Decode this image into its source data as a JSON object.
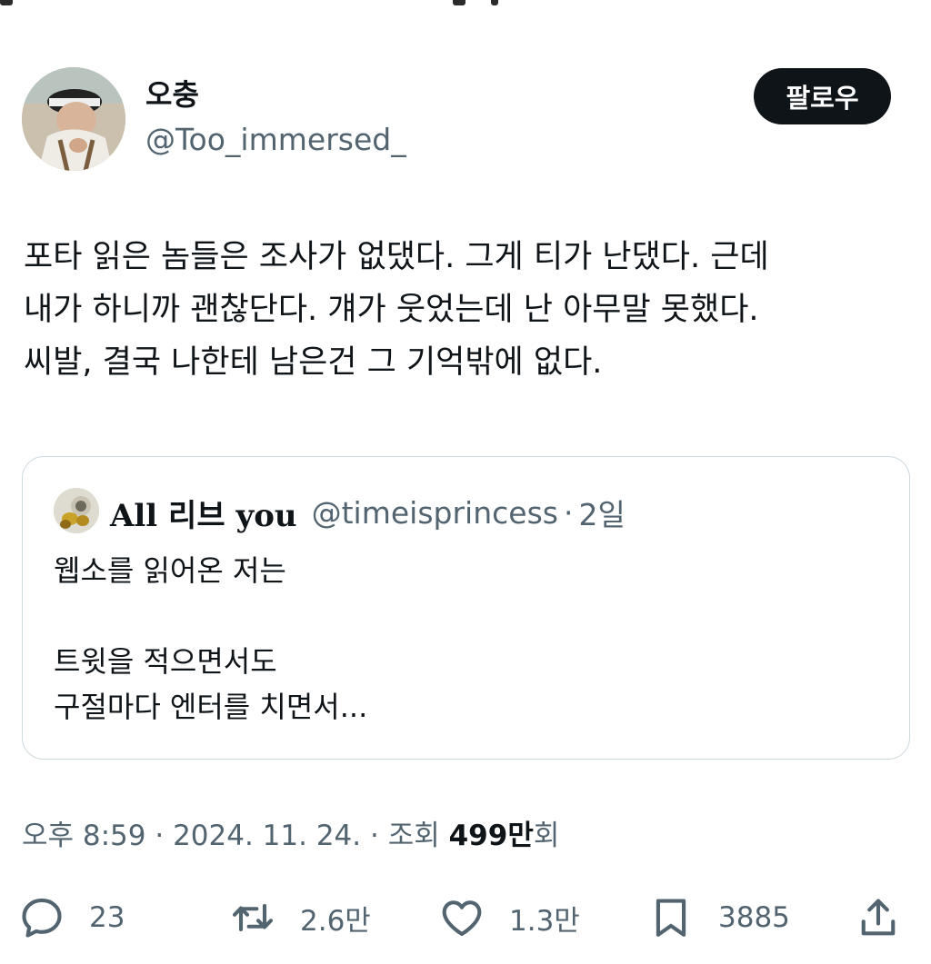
{
  "author": {
    "display_name": "오충",
    "handle": "@Too_immersed_"
  },
  "follow_button": {
    "label": "팔로우"
  },
  "tweet": {
    "lines": [
      "포타 읽은 놈들은 조사가 없댔다. 그게 티가 난댔다. 근데",
      "내가 하니까 괜찮단다. 걔가 웃었는데 난 아무말 못했다.",
      "씨발, 결국 나한테 남은건 그 기억밖에 없다."
    ]
  },
  "quote": {
    "display_name": "All 리브 you",
    "handle": "@timeisprincess",
    "separator": "·",
    "time": "2일",
    "lines": [
      "웹소를 읽어온 저는",
      "",
      "트윗을 적으면서도",
      "구절마다 엔터를 치면서..."
    ]
  },
  "meta": {
    "time": "오후 8:59",
    "separator": " · ",
    "date": "2024. 11. 24.",
    "views_prefix": "조회 ",
    "views_number": "499만",
    "views_suffix": "회"
  },
  "actions": {
    "reply_count": "23",
    "retweet_count": "2.6만",
    "like_count": "1.3만",
    "bookmark_count": "3885"
  },
  "icons": [
    "reply-icon",
    "retweet-icon",
    "like-icon",
    "bookmark-icon",
    "share-icon"
  ],
  "colors": {
    "text_primary": "#0f1419",
    "text_secondary": "#536471",
    "border": "#cfd9de",
    "follow_bg": "#0f1419"
  }
}
